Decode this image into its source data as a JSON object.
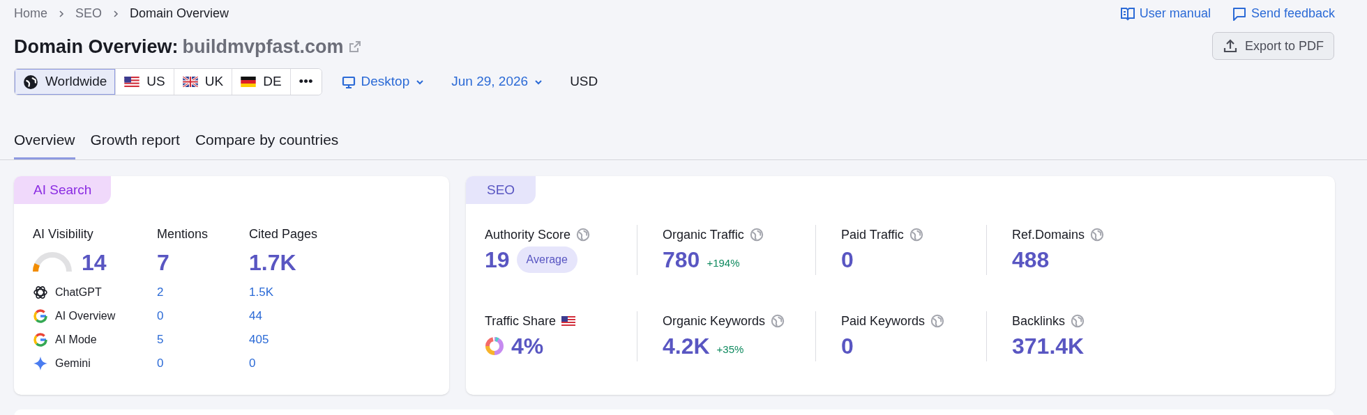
{
  "breadcrumbs": [
    "Home",
    "SEO",
    "Domain Overview"
  ],
  "header_links": [
    {
      "kind": "manual",
      "label": "User manual"
    },
    {
      "kind": "feedback",
      "label": "Send feedback"
    }
  ],
  "title": {
    "prefix": "Domain Overview:",
    "domain": "buildmvpfast.com"
  },
  "export_button": "Export to PDF",
  "databases": [
    {
      "kind": "world",
      "label": "Worldwide",
      "selected": true
    },
    {
      "kind": "us",
      "label": "US",
      "selected": false
    },
    {
      "kind": "uk",
      "label": "UK",
      "selected": false
    },
    {
      "kind": "de",
      "label": "DE",
      "selected": false
    },
    {
      "kind": "more",
      "label": "•••",
      "selected": false
    }
  ],
  "device": "Desktop",
  "date": "Jun 29, 2026",
  "currency": "USD",
  "tabs": [
    {
      "label": "Overview",
      "selected": true
    },
    {
      "label": "Growth report",
      "selected": false
    },
    {
      "label": "Compare by countries",
      "selected": false
    }
  ],
  "ai_search": {
    "tag": "AI Search",
    "columns": [
      "AI Visibility",
      "Mentions",
      "Cited Pages"
    ],
    "visibility": {
      "value": "14"
    },
    "mentions": "7",
    "cited_pages": "1.7K",
    "platforms": [
      {
        "kind": "chatgpt",
        "name": "ChatGPT",
        "mentions": "2",
        "cited": "1.5K"
      },
      {
        "kind": "google",
        "name": "AI Overview",
        "mentions": "0",
        "cited": "44"
      },
      {
        "kind": "google",
        "name": "AI Mode",
        "mentions": "5",
        "cited": "405"
      },
      {
        "kind": "gemini",
        "name": "Gemini",
        "mentions": "0",
        "cited": "0"
      }
    ]
  },
  "seo": {
    "tag": "SEO",
    "metrics": [
      {
        "kind": "worldwide",
        "label": "Authority Score",
        "value": "19",
        "badge": "Average"
      },
      {
        "kind": "worldwide",
        "label": "Organic Traffic",
        "value": "780",
        "change": "+194%"
      },
      {
        "kind": "worldwide",
        "label": "Paid Traffic",
        "value": "0"
      },
      {
        "kind": "worldwide",
        "label": "Ref.Domains",
        "value": "488"
      },
      {
        "kind": "share",
        "label": "Traffic Share",
        "value": "4%"
      },
      {
        "kind": "worldwide",
        "label": "Organic Keywords",
        "value": "4.2K",
        "change": "+35%"
      },
      {
        "kind": "worldwide",
        "label": "Paid Keywords",
        "value": "0"
      },
      {
        "kind": "worldwide",
        "label": "Backlinks",
        "value": "371.4K"
      }
    ]
  }
}
